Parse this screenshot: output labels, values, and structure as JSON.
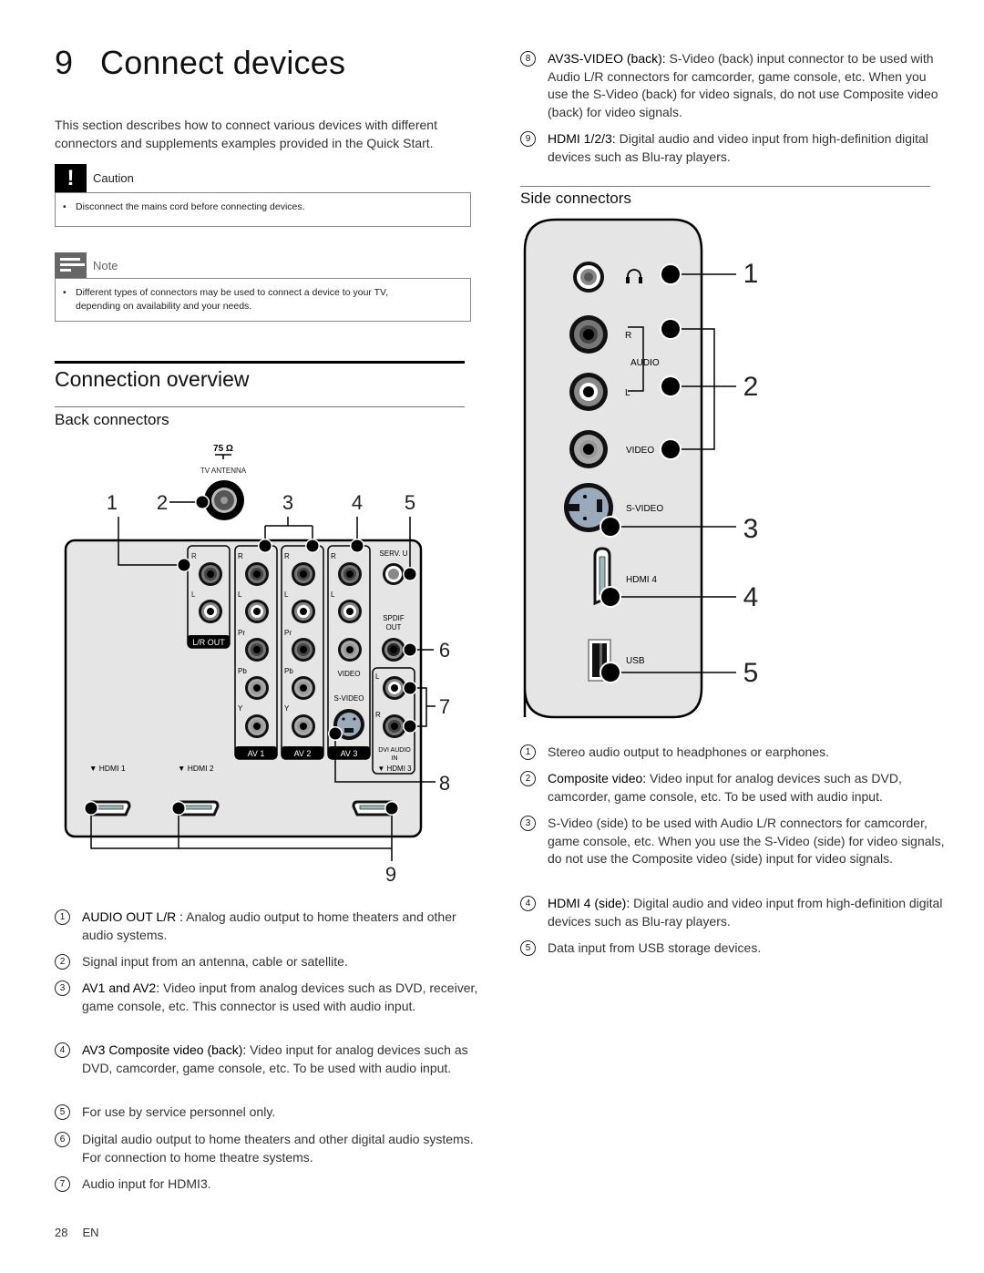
{
  "header": {
    "chapter_number": "9",
    "title": "Connect devices"
  },
  "intro": "This section describes how to connect various devices with different connectors and supplements examples provided in the Quick Start.",
  "caution": {
    "title": "Caution",
    "icon": "exclamation-icon",
    "items": [
      "Disconnect the mains cord before connecting devices."
    ]
  },
  "note": {
    "title": "Note",
    "icon": "note-lines-icon",
    "items": [
      "Different types of connectors may be used to connect a device to your TV, depending on availability and your needs."
    ]
  },
  "overview": {
    "title": "Connection overview"
  },
  "back": {
    "title": "Back connectors",
    "diagram": {
      "antenna_ohm": "75 Ω",
      "antenna_label": "TV ANTENNA",
      "callouts": [
        "1",
        "2",
        "3",
        "4",
        "5",
        "6",
        "7",
        "8",
        "9"
      ],
      "lr_out": {
        "r": "R",
        "l": "L",
        "label": "L/R OUT"
      },
      "av_groups": [
        {
          "label": "AV 1",
          "jacks": [
            "R",
            "L",
            "Pr",
            "Pb",
            "Y"
          ]
        },
        {
          "label": "AV 2",
          "jacks": [
            "R",
            "L",
            "Pr",
            "Pb",
            "Y"
          ]
        },
        {
          "label": "AV 3",
          "jacks": [
            "R",
            "L",
            "VIDEO",
            "S-VIDEO"
          ]
        }
      ],
      "serv_u": "SERV. U",
      "spdif": [
        "SPDIF",
        "OUT"
      ],
      "dvi": {
        "l": "L",
        "r": "R",
        "label": [
          "DVI AUDIO",
          "IN"
        ],
        "hdmi": "▼ HDMI 3"
      },
      "hdmi_labels": [
        "▼ HDMI 1",
        "▼ HDMI 2"
      ]
    },
    "items": [
      {
        "n": "1",
        "bold": "AUDIO OUT L/R :",
        "text": " Analog audio output to home theaters and other audio systems."
      },
      {
        "n": "2",
        "bold": "",
        "text": "Signal input from an antenna, cable or satellite."
      },
      {
        "n": "3",
        "bold": "AV1 and AV2:",
        "text": " Video input from analog devices such as DVD, receiver, game console, etc. This connector is used with audio input."
      },
      {
        "n": "4",
        "bold": "AV3 Composite video (back):",
        "text": " Video input for analog devices such as DVD, camcorder, game console, etc. To be used with audio input."
      },
      {
        "n": "5",
        "bold": "",
        "text": "For use by service personnel only."
      },
      {
        "n": "6",
        "bold": "",
        "text": "Digital audio output to home theaters and other digital audio systems. For connection to home theatre systems."
      },
      {
        "n": "7",
        "bold": "",
        "text": "Audio input for HDMI3."
      },
      {
        "n": "8",
        "bold": "AV3S-VIDEO (back):",
        "text": " S-Video (back) input connector to be used with Audio L/R connectors for camcorder, game console, etc. When you use the S-Video (back) for video signals, do not use Composite video (back) for video signals."
      },
      {
        "n": "9",
        "bold": "HDMI 1/2/3:",
        "text": " Digital audio and video input from high-definition digital devices such as Blu-ray players."
      }
    ]
  },
  "side": {
    "title": "Side connectors",
    "diagram": {
      "callouts": [
        "1",
        "2",
        "3",
        "4",
        "5"
      ],
      "audio_r": "R",
      "audio_label": "AUDIO",
      "audio_l": "L",
      "video": "VIDEO",
      "svideo": "S-VIDEO",
      "hdmi4": "HDMI 4",
      "usb": "USB"
    },
    "items": [
      {
        "n": "1",
        "bold": "",
        "text": "Stereo audio output to headphones or earphones."
      },
      {
        "n": "2",
        "bold": "Composite video:",
        "text": " Video input for analog devices such as DVD, camcorder, game console, etc. To be used with audio input."
      },
      {
        "n": "3",
        "bold": "",
        "text": "S-Video (side) to be used with Audio L/R connectors for camcorder, game console, etc. When you use the S-Video (side) for video signals, do not use the Composite video (side) input for video signals."
      },
      {
        "n": "4",
        "bold": "HDMI 4 (side):",
        "text": " Digital audio and video input from high-definition digital devices such as Blu-ray players."
      },
      {
        "n": "5",
        "bold": "",
        "text": "Data input from USB storage devices."
      }
    ]
  },
  "footer": {
    "page": "28",
    "lang": "EN"
  }
}
